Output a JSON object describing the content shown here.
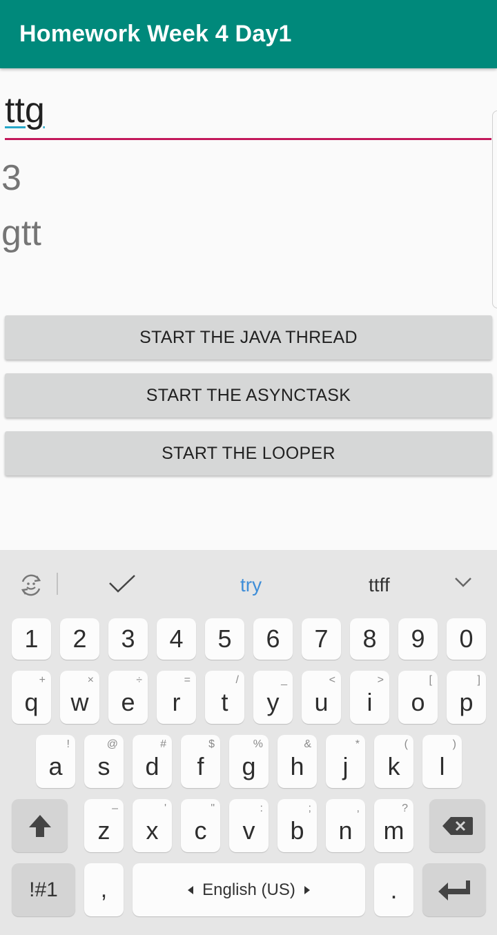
{
  "app": {
    "title": "Homework Week 4 Day1"
  },
  "input": {
    "value": "ttg"
  },
  "output": {
    "line1": "3",
    "line2": "gtt"
  },
  "buttons": {
    "java_thread": "START THE JAVA THREAD",
    "asynctask": "START THE ASYNCTASK",
    "looper": "START THE LOOPER"
  },
  "colors": {
    "appbar": "#00897b",
    "input_underline": "#c2185b",
    "suggestion_highlight": "#3f8ed8"
  },
  "keyboard": {
    "suggestions": {
      "word1": "try",
      "word2": "ttff"
    },
    "number_row": [
      "1",
      "2",
      "3",
      "4",
      "5",
      "6",
      "7",
      "8",
      "9",
      "0"
    ],
    "row1": [
      {
        "key": "q",
        "alt": "+"
      },
      {
        "key": "w",
        "alt": "×"
      },
      {
        "key": "e",
        "alt": "÷"
      },
      {
        "key": "r",
        "alt": "="
      },
      {
        "key": "t",
        "alt": "/"
      },
      {
        "key": "y",
        "alt": "_"
      },
      {
        "key": "u",
        "alt": "<"
      },
      {
        "key": "i",
        "alt": ">"
      },
      {
        "key": "o",
        "alt": "["
      },
      {
        "key": "p",
        "alt": "]"
      }
    ],
    "row2": [
      {
        "key": "a",
        "alt": "!"
      },
      {
        "key": "s",
        "alt": "@"
      },
      {
        "key": "d",
        "alt": "#"
      },
      {
        "key": "f",
        "alt": "$"
      },
      {
        "key": "g",
        "alt": "%"
      },
      {
        "key": "h",
        "alt": "&"
      },
      {
        "key": "j",
        "alt": "*"
      },
      {
        "key": "k",
        "alt": "("
      },
      {
        "key": "l",
        "alt": ")"
      }
    ],
    "row3": [
      {
        "key": "z",
        "alt": "–"
      },
      {
        "key": "x",
        "alt": "'"
      },
      {
        "key": "c",
        "alt": "\""
      },
      {
        "key": "v",
        "alt": ":"
      },
      {
        "key": "b",
        "alt": ";"
      },
      {
        "key": "n",
        "alt": ","
      },
      {
        "key": "m",
        "alt": "?"
      }
    ],
    "symbols_label": "!#1",
    "comma": ",",
    "language": "English (US)",
    "period": "."
  }
}
